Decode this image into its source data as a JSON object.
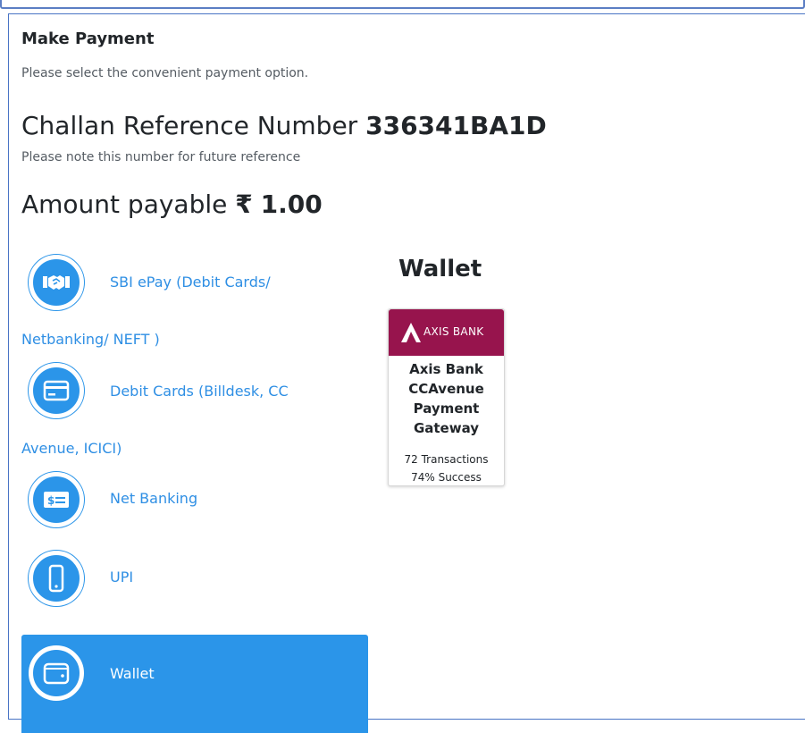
{
  "header": {
    "title": "Make Payment",
    "subtitle": "Please select the convenient payment option."
  },
  "challan": {
    "label": "Challan Reference Number",
    "number": "336341BA1D",
    "note": "Please note this number for future reference"
  },
  "amount": {
    "label": "Amount payable",
    "currency_symbol": "₹",
    "value": "1.00"
  },
  "payment_options": [
    {
      "line1": "SBI ePay (Debit Cards/",
      "line2": "Netbanking/ NEFT )",
      "icon": "handshake-icon",
      "selected": false
    },
    {
      "line1": "Debit Cards (Billdesk, CC",
      "line2": "Avenue, ICICI)",
      "icon": "credit-card-icon",
      "selected": false
    },
    {
      "line1": "Net Banking",
      "icon": "banknote-icon",
      "selected": false
    },
    {
      "line1": "UPI",
      "icon": "mobile-phone-icon",
      "selected": false
    },
    {
      "line1": "Wallet",
      "icon": "wallet-icon",
      "selected": true
    }
  ],
  "wallet_panel": {
    "heading": "Wallet",
    "gateways": [
      {
        "brand": "AXIS BANK",
        "brand_color": "#97144d",
        "name": "Axis Bank CCAvenue Payment Gateway",
        "transactions": "72 Transactions",
        "success": "74% Success"
      }
    ]
  },
  "colors": {
    "accent": "#2b95e9",
    "link": "#2f8fe4",
    "panel_border": "#4a74c5"
  }
}
